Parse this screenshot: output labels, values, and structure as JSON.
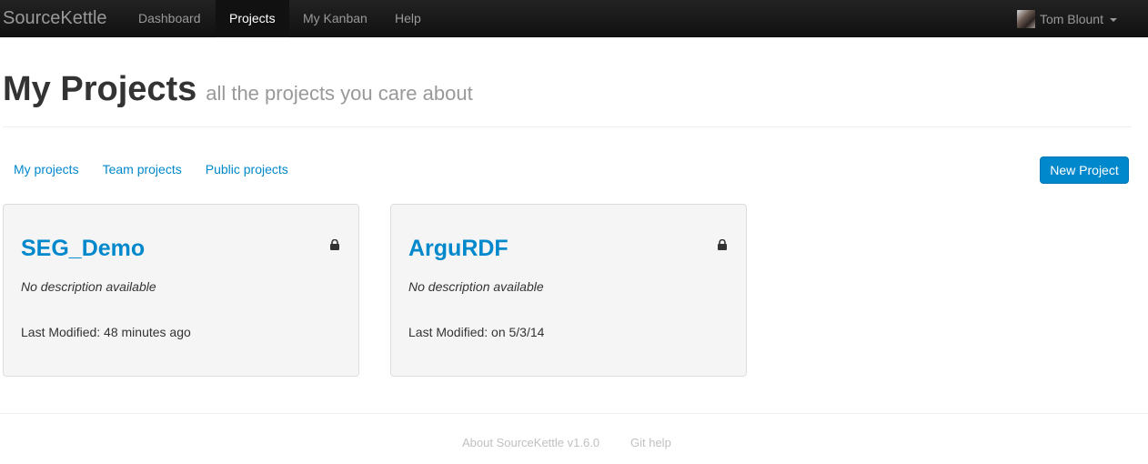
{
  "navbar": {
    "brand": "SourceKettle",
    "items": [
      {
        "label": "Dashboard",
        "active": false
      },
      {
        "label": "Projects",
        "active": true
      },
      {
        "label": "My Kanban",
        "active": false
      },
      {
        "label": "Help",
        "active": false
      }
    ],
    "user": {
      "name": "Tom Blount",
      "avatar_icon": "user-avatar"
    }
  },
  "header": {
    "title": "My Projects",
    "subtitle": "all the projects you care about"
  },
  "filters": [
    "My projects",
    "Team projects",
    "Public projects"
  ],
  "new_project_label": "New Project",
  "projects": [
    {
      "name": "SEG_Demo",
      "description": "No description available",
      "last_modified": "Last Modified: 48 minutes ago",
      "icon": "lock-icon"
    },
    {
      "name": "ArguRDF",
      "description": "No description available",
      "last_modified": "Last Modified: on 5/3/14",
      "icon": "lock-icon"
    }
  ],
  "footer": {
    "about": "About SourceKettle v1.6.0",
    "git_help": "Git help"
  },
  "colors": {
    "link": "#0088cc",
    "navbar_bg": "#111111",
    "card_bg": "#f5f5f5",
    "muted": "#999999"
  }
}
